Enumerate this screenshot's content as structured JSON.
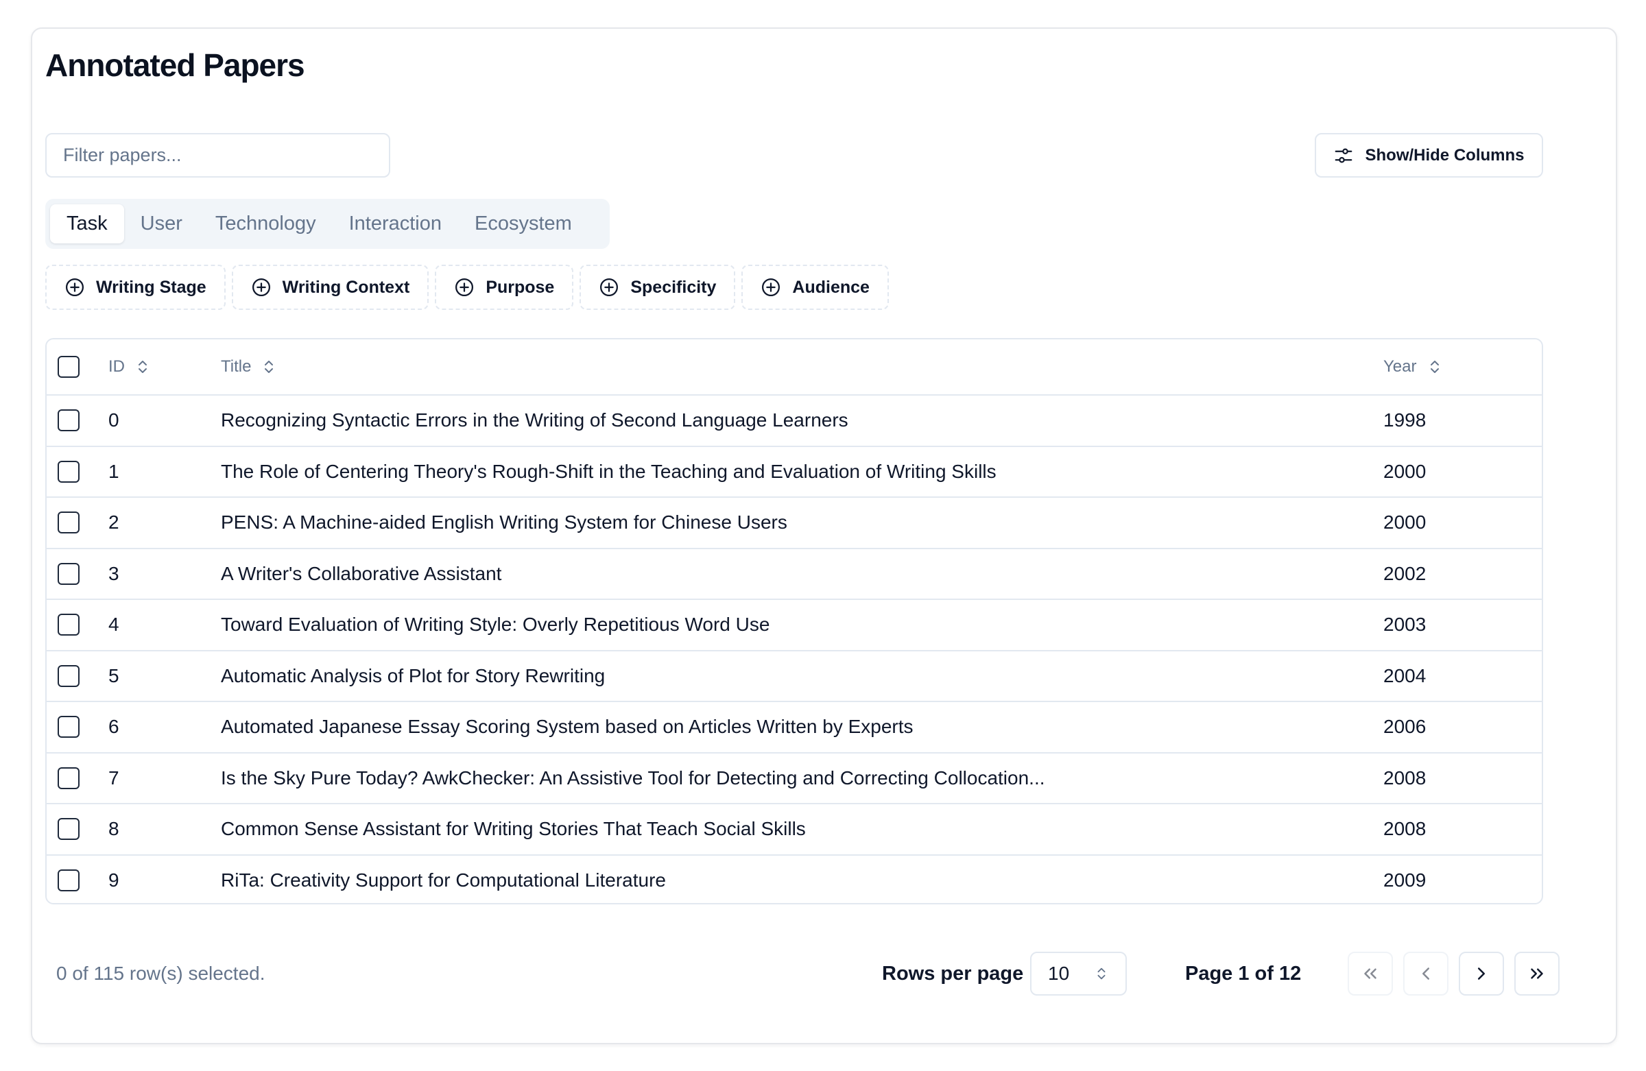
{
  "page": {
    "title": "Annotated Papers"
  },
  "filter": {
    "placeholder": "Filter papers..."
  },
  "columns_button": {
    "label": "Show/Hide Columns",
    "icon": "sliders-icon"
  },
  "tabs": [
    {
      "label": "Task",
      "active": true
    },
    {
      "label": "User",
      "active": false
    },
    {
      "label": "Technology",
      "active": false
    },
    {
      "label": "Interaction",
      "active": false
    },
    {
      "label": "Ecosystem",
      "active": false
    }
  ],
  "filter_chips": [
    {
      "label": "Writing Stage",
      "icon": "plus-circle-icon"
    },
    {
      "label": "Writing Context",
      "icon": "plus-circle-icon"
    },
    {
      "label": "Purpose",
      "icon": "plus-circle-icon"
    },
    {
      "label": "Specificity",
      "icon": "plus-circle-icon"
    },
    {
      "label": "Audience",
      "icon": "plus-circle-icon"
    }
  ],
  "table": {
    "headers": {
      "id": "ID",
      "title": "Title",
      "year": "Year"
    },
    "rows": [
      {
        "id": "0",
        "title": "Recognizing Syntactic Errors in the Writing of Second Language Learners",
        "year": "1998"
      },
      {
        "id": "1",
        "title": "The Role of Centering Theory's Rough-Shift in the Teaching and Evaluation of Writing Skills",
        "year": "2000"
      },
      {
        "id": "2",
        "title": "PENS: A Machine-aided English Writing System for Chinese Users",
        "year": "2000"
      },
      {
        "id": "3",
        "title": "A Writer's Collaborative Assistant",
        "year": "2002"
      },
      {
        "id": "4",
        "title": "Toward Evaluation of Writing Style: Overly Repetitious Word Use",
        "year": "2003"
      },
      {
        "id": "5",
        "title": "Automatic Analysis of Plot for Story Rewriting",
        "year": "2004"
      },
      {
        "id": "6",
        "title": "Automated Japanese Essay Scoring System based on Articles Written by Experts",
        "year": "2006"
      },
      {
        "id": "7",
        "title": "Is the Sky Pure Today? AwkChecker: An Assistive Tool for Detecting and Correcting Collocation...",
        "year": "2008"
      },
      {
        "id": "8",
        "title": "Common Sense Assistant for Writing Stories That Teach Social Skills",
        "year": "2008"
      },
      {
        "id": "9",
        "title": "RiTa: Creativity Support for Computational Literature",
        "year": "2009"
      }
    ]
  },
  "footer": {
    "selected_text": "0 of 115 row(s) selected.",
    "rows_per_page_label": "Rows per page",
    "rows_per_page_value": "10",
    "page_info": "Page 1 of 12"
  },
  "colors": {
    "border": "#e2e8f0",
    "muted": "#64748b",
    "text": "#0f172a"
  }
}
